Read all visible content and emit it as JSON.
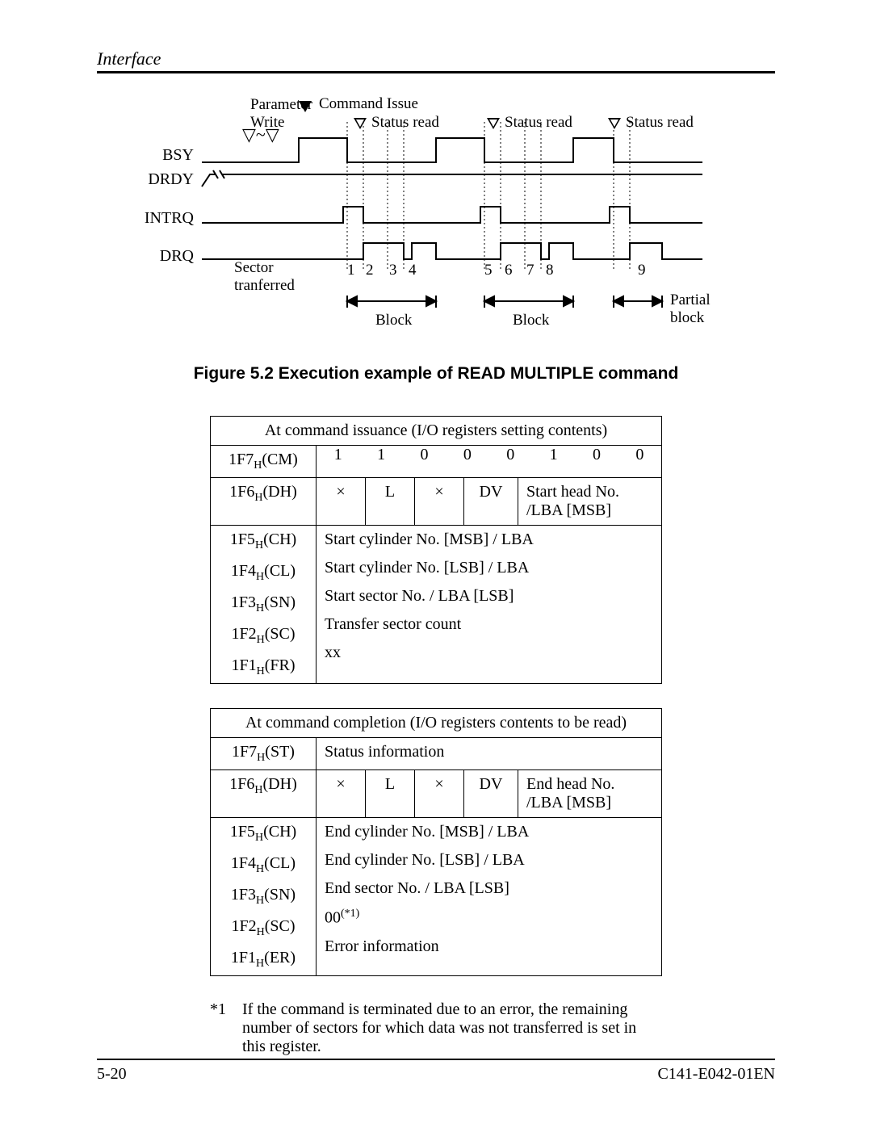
{
  "header": {
    "section": "Interface"
  },
  "diagram": {
    "labels": {
      "param_write": "Parameter\nWrite",
      "cmd_issue": "Command Issue",
      "status_read": "Status read",
      "bsy": "BSY",
      "drdy": "DRDY",
      "intrq": "INTRQ",
      "drq": "DRQ",
      "sector_transferred": "Sector\ntranferred",
      "ticks": [
        "1",
        "2",
        "3",
        "4",
        "5",
        "6",
        "7",
        "8",
        "9"
      ],
      "block": "Block",
      "partial_block": "Partial\nblock"
    }
  },
  "figure_caption": "Figure 5.2  Execution example of READ MULTIPLE command",
  "table1": {
    "title": "At command issuance (I/O registers setting contents)",
    "rows": {
      "cm": {
        "reg": "1F7",
        "sub": "H",
        "name": "(CM)",
        "bits": [
          "1",
          "1",
          "0",
          "0",
          "0",
          "1",
          "0",
          "0"
        ]
      },
      "dh": {
        "reg": "1F6",
        "sub": "H",
        "name": "(DH)",
        "c1": "×",
        "c2": "L",
        "c3": "×",
        "c4": "DV",
        "c5": "Start head No. /LBA [MSB]"
      },
      "ch": {
        "reg": "1F5",
        "sub": "H",
        "name": "(CH)",
        "val": "Start cylinder No. [MSB] / LBA"
      },
      "cl": {
        "reg": "1F4",
        "sub": "H",
        "name": "(CL)",
        "val": "Start cylinder No. [LSB] / LBA"
      },
      "sn": {
        "reg": "1F3",
        "sub": "H",
        "name": "(SN)",
        "val": "Start sector No. / LBA [LSB]"
      },
      "sc": {
        "reg": "1F2",
        "sub": "H",
        "name": "(SC)",
        "val": "Transfer sector count"
      },
      "fr": {
        "reg": "1F1",
        "sub": "H",
        "name": "(FR)",
        "val": "xx"
      }
    }
  },
  "table2": {
    "title": "At command completion (I/O registers contents to be read)",
    "rows": {
      "st": {
        "reg": "1F7",
        "sub": "H",
        "name": "(ST)",
        "val": "Status information"
      },
      "dh": {
        "reg": "1F6",
        "sub": "H",
        "name": "(DH)",
        "c1": "×",
        "c2": "L",
        "c3": "×",
        "c4": "DV",
        "c5": "End head No. /LBA [MSB]"
      },
      "ch": {
        "reg": "1F5",
        "sub": "H",
        "name": "(CH)",
        "val": "End cylinder No. [MSB] / LBA"
      },
      "cl": {
        "reg": "1F4",
        "sub": "H",
        "name": "(CL)",
        "val": "End cylinder No. [LSB] / LBA"
      },
      "sn": {
        "reg": "1F3",
        "sub": "H",
        "name": "(SN)",
        "val": "End sector No. / LBA [LSB]"
      },
      "sc": {
        "reg": "1F2",
        "sub": "H",
        "name": "(SC)",
        "val": "00",
        "sup": "(*1)"
      },
      "er": {
        "reg": "1F1",
        "sub": "H",
        "name": "(ER)",
        "val": "Error information"
      }
    }
  },
  "footnote": {
    "marker": "*1",
    "text": "If the command is terminated due to an error, the remaining number of sectors for which data was not transferred is set in this register."
  },
  "footer": {
    "page": "5-20",
    "doc": "C141-E042-01EN"
  }
}
